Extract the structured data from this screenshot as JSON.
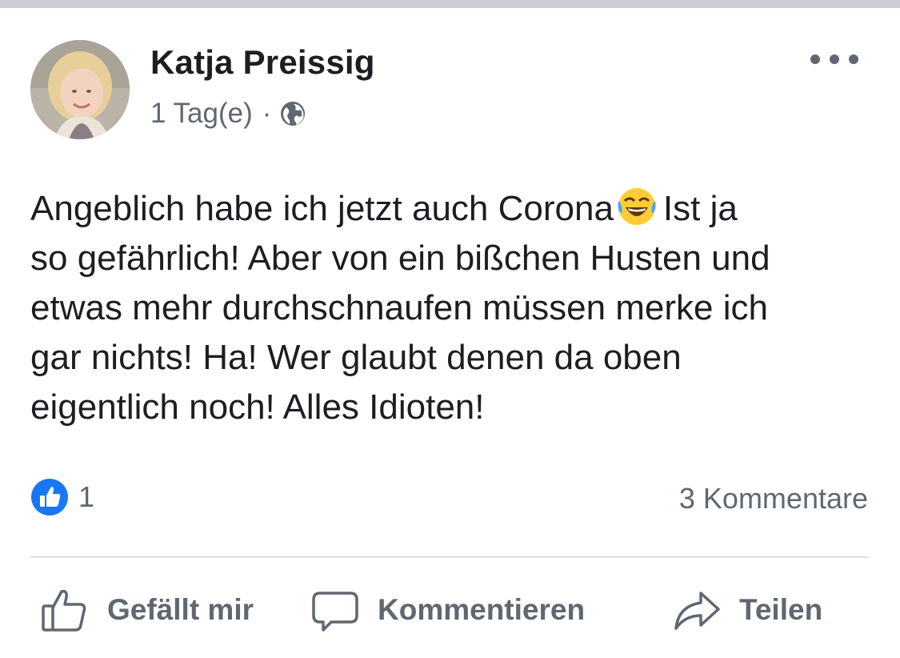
{
  "post": {
    "author": "Katja Preissig",
    "timestamp": "1 Tag(e)",
    "separator": "·",
    "audience_icon": "globe-icon",
    "more_icon": "more-options-icon",
    "text_lines": [
      {
        "before": "Angeblich habe ich jetzt auch Corona",
        "emoji": "face-with-tears-of-joy-emoji",
        "after": "Ist ja"
      },
      {
        "text": "so gefährlich! Aber von ein bißchen Husten und"
      },
      {
        "text": "etwas mehr durchschnaufen müssen merke ich"
      },
      {
        "text": "gar nichts! Ha! Wer glaubt denen da oben"
      },
      {
        "text": "eigentlich noch! Alles Idioten!"
      }
    ]
  },
  "stats": {
    "like_icon": "like-reaction-icon",
    "like_count": "1",
    "comments": "3 Kommentare"
  },
  "actions": {
    "like_label": "Gefällt mir",
    "like_icon": "thumbs-up-icon",
    "comment_label": "Kommentieren",
    "comment_icon": "speech-bubble-icon",
    "share_label": "Teilen",
    "share_icon": "share-arrow-icon"
  },
  "colors": {
    "like_blue": "#1877f2",
    "secondary_text": "#606770",
    "primary_text": "#1c1e21",
    "divider": "#dadde1",
    "emoji_yellow": "#ffcc33"
  }
}
